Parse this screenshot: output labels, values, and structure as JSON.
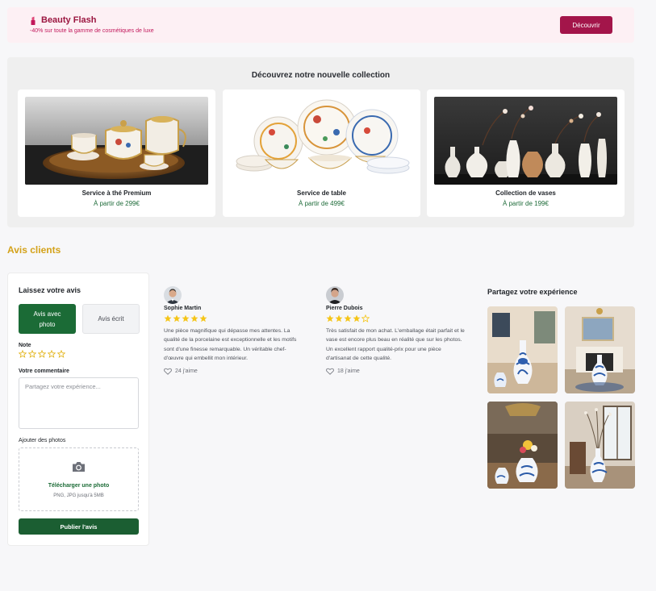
{
  "flash": {
    "icon": "lipstick-icon",
    "title": "Beauty Flash",
    "subtitle": "-40% sur toute la gamme de cosmétiques de luxe",
    "button_label": "Découvrir",
    "accent_color": "#a3154a"
  },
  "collection": {
    "title": "Découvrez notre nouvelle collection",
    "products": [
      {
        "name": "Service à thé Premium",
        "price": "À partir de 299€"
      },
      {
        "name": "Service de table",
        "price": "À partir de 499€"
      },
      {
        "name": "Collection de vases",
        "price": "À partir de 199€"
      }
    ]
  },
  "reviews": {
    "heading": "Avis clients",
    "form": {
      "title": "Laissez votre avis",
      "tab_photo_label": "Avis avec photo",
      "tab_text_label": "Avis écrit",
      "rating_label": "Note",
      "rating_value": 0,
      "rating_max": 5,
      "comment_label": "Votre commentaire",
      "comment_placeholder": "Partagez votre expérience...",
      "photos_label": "Ajouter des photos",
      "upload_label": "Télécharger une photo",
      "upload_hint": "PNG, JPG jusqu'à 5MB",
      "submit_label": "Publier l'avis"
    },
    "items": [
      {
        "author": "Sophie Martin",
        "rating": 5,
        "text": "Une pièce magnifique qui dépasse mes attentes. La qualité de la porcelaine est exceptionnelle et les motifs sont d'une finesse remarquable. Un véritable chef-d'œuvre qui embellit mon intérieur.",
        "likes": "24 j'aime"
      },
      {
        "author": "Pierre Dubois",
        "rating": 4,
        "text": "Très satisfait de mon achat. L'emballage était parfait et le vase est encore plus beau en réalité que sur les photos. Un excellent rapport qualité-prix pour une pièce d'artisanat de cette qualité.",
        "likes": "18 j'aime"
      }
    ],
    "share_title": "Partagez votre expérience"
  },
  "colors": {
    "brand_green": "#1b6b36",
    "price_green": "#1e6b39",
    "heading_gold": "#d4a21a",
    "star_gold": "#f5c518"
  }
}
